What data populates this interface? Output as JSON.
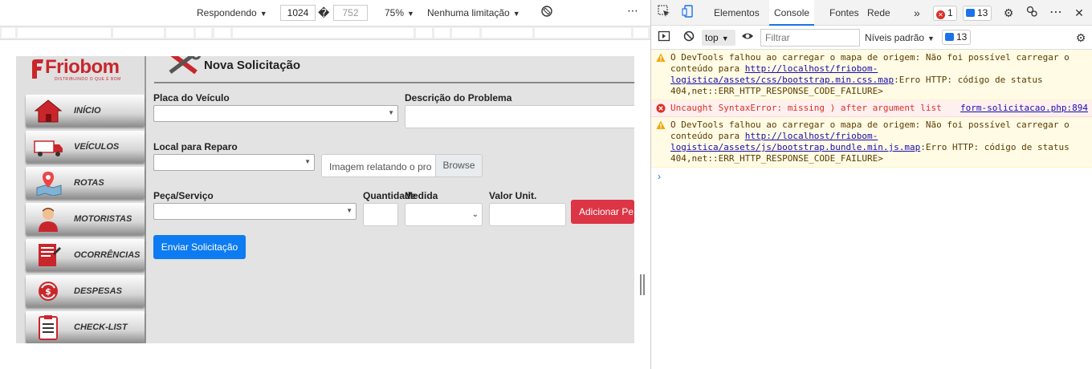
{
  "device_toolbar": {
    "device": "Respondendo",
    "width": "1024",
    "separator": "�",
    "height": "752",
    "zoom": "75%",
    "throttle": "Nenhuma limitação"
  },
  "app": {
    "logo_text": "Friobom",
    "logo_tagline": "DISTRIBUINDO O QUE É BOM",
    "menu": [
      {
        "label": "INÍCIO",
        "icon": "house-icon"
      },
      {
        "label": "VEÍCULOS",
        "icon": "truck-icon"
      },
      {
        "label": "ROTAS",
        "icon": "map-pin-icon"
      },
      {
        "label": "MOTORISTAS",
        "icon": "driver-icon"
      },
      {
        "label": "OCORRÊNCIAS",
        "icon": "report-icon"
      },
      {
        "label": "DESPESAS",
        "icon": "money-icon"
      },
      {
        "label": "CHECK-LIST",
        "icon": "clipboard-icon"
      }
    ],
    "page_title": "Nova Solicitação",
    "form": {
      "placa_label": "Placa do Veículo",
      "descricao_label": "Descrição do Problema",
      "local_label": "Local para Reparo",
      "file_placeholder": "Imagem relatando o pro",
      "browse_label": "Browse",
      "peca_label": "Peça/Serviço",
      "quantidade_label": "Quantidade",
      "medida_label": "Medida",
      "valor_label": "Valor Unit.",
      "add_label": "Adicionar Pe",
      "submit_label": "Enviar Solicitação"
    },
    "colors": {
      "brand": "#c9262c",
      "primary": "#0d7bf2",
      "danger": "#dc3545"
    }
  },
  "devtools": {
    "tabs": [
      "Elementos",
      "Console",
      "Fontes",
      "Rede"
    ],
    "active_tab": "Console",
    "more_tabs": "»",
    "error_count": "1",
    "message_count": "13",
    "context": "top",
    "filter_placeholder": "Filtrar",
    "levels": "Níveis padrão",
    "levels_count": "13",
    "messages": [
      {
        "type": "warning",
        "text_before": "O DevTools falhou ao carregar o mapa de origem: Não foi possível carregar o conteúdo para ",
        "link": "http://localhost/friobom-logistica/assets/css/bootstrap.min.css.map",
        "text_after": ":Erro HTTP: código de status 404,net::ERR_HTTP_RESPONSE_CODE_FAILURE>"
      },
      {
        "type": "error",
        "text_before": "Uncaught SyntaxError: missing ) after argument list",
        "link": "form-solicitacao.php:894",
        "text_after": ""
      },
      {
        "type": "warning",
        "text_before": "O DevTools falhou ao carregar o mapa de origem: Não foi possível carregar o conteúdo para ",
        "link": "http://localhost/friobom-logistica/assets/js/bootstrap.bundle.min.js.map",
        "text_after": ":Erro HTTP: código de status 404,net::ERR_HTTP_RESPONSE_CODE_FAILURE>"
      }
    ],
    "prompt": "›"
  }
}
